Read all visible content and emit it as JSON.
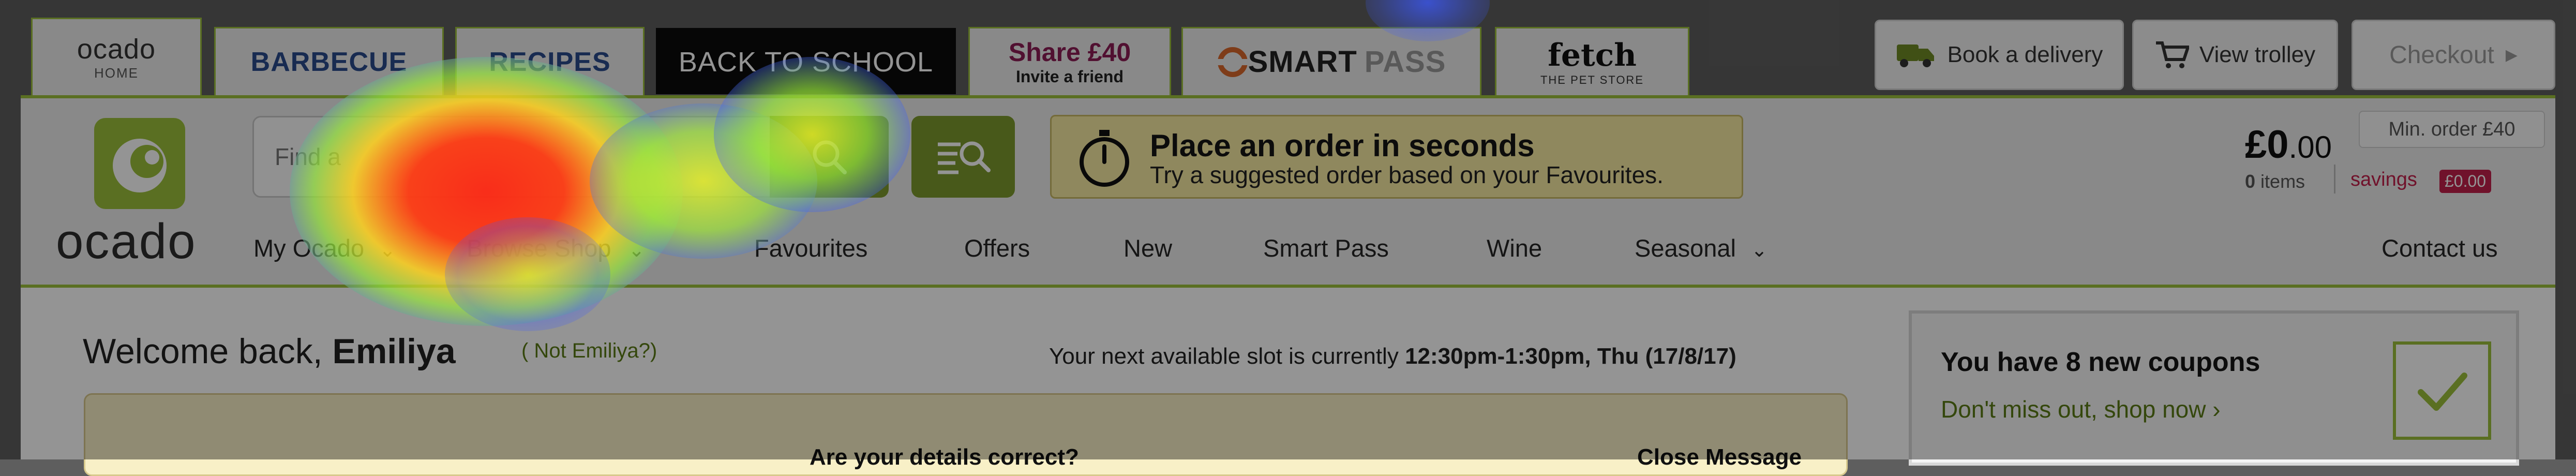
{
  "top_tabs": {
    "home": {
      "line1": "ocado",
      "line2": "HOME"
    },
    "barbecue": "BARBECUE",
    "recipes": "RECIPES",
    "back_to_school": "BACK TO SCHOOL",
    "share": {
      "line1": "Share £40",
      "line2": "Invite a friend"
    },
    "smartpass": {
      "smart": "SMART",
      "pass": "PASS"
    },
    "fetch": {
      "line1": "fetch",
      "line2": "THE PET STORE"
    }
  },
  "top_buttons": {
    "book_delivery": "Book a delivery",
    "view_trolley": "View trolley",
    "checkout": "Checkout"
  },
  "logo": {
    "wordmark": "ocado"
  },
  "search": {
    "placeholder": "Find a"
  },
  "promo": {
    "title": "Place an order in seconds",
    "subtitle": "Try a suggested order based on your Favourites."
  },
  "basket": {
    "price_main": "£0",
    "price_cents": ".00",
    "min_order": "Min. order £40",
    "items": "0 items",
    "items_count": "0",
    "items_word": "items",
    "savings_label": "savings",
    "savings_value": "£0.00"
  },
  "nav": {
    "my_ocado": "My Ocado",
    "browse_shop": "Browse Shop",
    "favourites": "Favourites",
    "offers": "Offers",
    "new": "New",
    "smart_pass": "Smart Pass",
    "wine": "Wine",
    "seasonal": "Seasonal",
    "contact": "Contact us"
  },
  "welcome": {
    "prefix": "Welcome back,",
    "name": "Emiliya",
    "not_link": "( Not Emiliya?)",
    "slot_prefix": "Your next available slot is currently",
    "slot_value": "12:30pm-1:30pm, Thu (17/8/17)"
  },
  "notice": {
    "text": "Are your details correct?",
    "close": "Close Message"
  },
  "coupons": {
    "title": "You have 8 new coupons",
    "link": "Don't miss out, shop now ›"
  },
  "colors": {
    "brand_green": "#9cbf3b",
    "button_green": "#7d9a2d",
    "savings_red": "#c21f4b",
    "navy": "#2a4b8c"
  }
}
